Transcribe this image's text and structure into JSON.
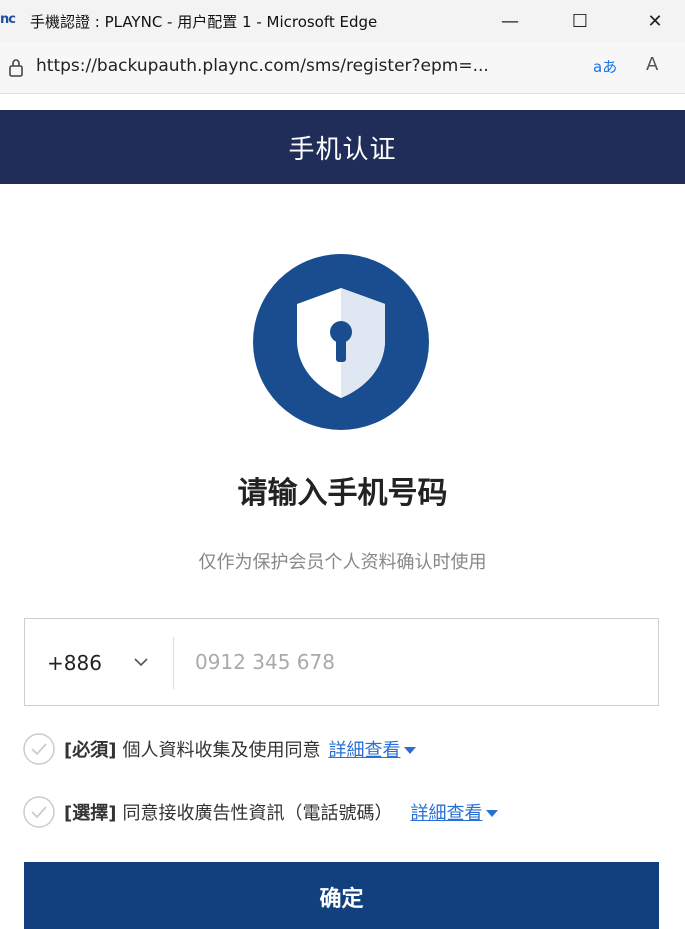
{
  "window": {
    "app_logo": "nc",
    "title": "手機認證 : PLAYNC - 用户配置 1 - Microsoft Edge",
    "minimize_glyph": "—",
    "maximize_glyph": "☐",
    "close_glyph": "✕"
  },
  "browser": {
    "url": "https://backupauth.plaync.com/sms/register?epm=...",
    "read_aloud": "aあ",
    "font_a": "A"
  },
  "page": {
    "header_title": "手机认证",
    "heading": "请输入手机号码",
    "subtext": "仅作为保护会员个人资料确认时使用"
  },
  "phone": {
    "country_code": "+886",
    "placeholder": "0912 345 678"
  },
  "agreements": [
    {
      "tag": "[必須]",
      "text": "個人資料收集及使用同意",
      "link": "詳細查看"
    },
    {
      "tag": "[選擇]",
      "text": "同意接收廣告性資訊（電話號碼）",
      "link": "詳細查看"
    }
  ],
  "confirm_label": "确定",
  "colors": {
    "header_bg": "#1f2d58",
    "shield_circle": "#1a4d8f",
    "button_bg": "#12407f",
    "link": "#2a6fd6"
  },
  "icons": {
    "lock": "lock-icon",
    "shield": "shield-keyhole-icon",
    "chevron": "chevron-down-icon",
    "check": "check-circle-icon",
    "caret": "caret-down-icon"
  }
}
